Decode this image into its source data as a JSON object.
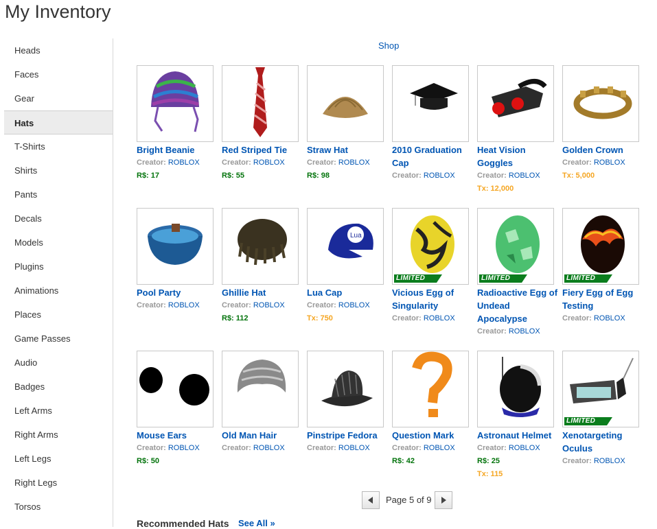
{
  "page": {
    "title": "My Inventory",
    "shop_link": "Shop"
  },
  "sidebar": {
    "items": [
      {
        "label": "Heads"
      },
      {
        "label": "Faces"
      },
      {
        "label": "Gear"
      },
      {
        "label": "Hats"
      },
      {
        "label": "T-Shirts"
      },
      {
        "label": "Shirts"
      },
      {
        "label": "Pants"
      },
      {
        "label": "Decals"
      },
      {
        "label": "Models"
      },
      {
        "label": "Plugins"
      },
      {
        "label": "Animations"
      },
      {
        "label": "Places"
      },
      {
        "label": "Game Passes"
      },
      {
        "label": "Audio"
      },
      {
        "label": "Badges"
      },
      {
        "label": "Left Arms"
      },
      {
        "label": "Right Arms"
      },
      {
        "label": "Left Legs"
      },
      {
        "label": "Right Legs"
      },
      {
        "label": "Torsos"
      }
    ],
    "active": "Hats"
  },
  "creator_label": "Creator: ",
  "limited_label": "LIMITED",
  "items": [
    {
      "name": "Bright Beanie",
      "creator": "ROBLOX",
      "rs": "R$: 17",
      "tx": "",
      "limited": false,
      "icon": "beanie-icon"
    },
    {
      "name": "Red Striped Tie",
      "creator": "ROBLOX",
      "rs": "R$: 55",
      "tx": "",
      "limited": false,
      "icon": "tie-icon"
    },
    {
      "name": "Straw Hat",
      "creator": "ROBLOX",
      "rs": "R$: 98",
      "tx": "",
      "limited": false,
      "icon": "straw-hat-icon"
    },
    {
      "name": "2010 Graduation Cap",
      "creator": "ROBLOX",
      "rs": "",
      "tx": "",
      "limited": false,
      "icon": "graduation-cap-icon"
    },
    {
      "name": "Heat Vision Goggles",
      "creator": "ROBLOX",
      "rs": "",
      "tx": "Tx: 12,000",
      "limited": false,
      "icon": "goggles-icon"
    },
    {
      "name": "Golden Crown",
      "creator": "ROBLOX",
      "rs": "",
      "tx": "Tx: 5,000",
      "limited": false,
      "icon": "crown-icon"
    },
    {
      "name": "Pool Party",
      "creator": "ROBLOX",
      "rs": "",
      "tx": "",
      "limited": false,
      "icon": "pool-icon"
    },
    {
      "name": "Ghillie Hat",
      "creator": "ROBLOX",
      "rs": "R$: 112",
      "tx": "",
      "limited": false,
      "icon": "ghillie-hat-icon"
    },
    {
      "name": "Lua Cap",
      "creator": "ROBLOX",
      "rs": "",
      "tx": "Tx: 750",
      "limited": false,
      "icon": "lua-cap-icon"
    },
    {
      "name": "Vicious Egg of Singularity",
      "creator": "ROBLOX",
      "rs": "",
      "tx": "",
      "limited": true,
      "icon": "yellow-egg-icon"
    },
    {
      "name": "Radioactive Egg of Undead Apocalypse",
      "creator": "ROBLOX",
      "rs": "",
      "tx": "",
      "limited": true,
      "icon": "green-egg-icon"
    },
    {
      "name": "Fiery Egg of Egg Testing",
      "creator": "ROBLOX",
      "rs": "",
      "tx": "",
      "limited": true,
      "icon": "fiery-egg-icon"
    },
    {
      "name": "Mouse Ears",
      "creator": "ROBLOX",
      "rs": "R$: 50",
      "tx": "",
      "limited": false,
      "icon": "mouse-ears-icon"
    },
    {
      "name": "Old Man Hair",
      "creator": "ROBLOX",
      "rs": "",
      "tx": "",
      "limited": false,
      "icon": "hair-icon"
    },
    {
      "name": "Pinstripe Fedora",
      "creator": "ROBLOX",
      "rs": "",
      "tx": "",
      "limited": false,
      "icon": "fedora-icon"
    },
    {
      "name": "Question Mark",
      "creator": "ROBLOX",
      "rs": "R$: 42",
      "tx": "",
      "limited": false,
      "icon": "question-mark-icon"
    },
    {
      "name": "Astronaut Helmet",
      "creator": "ROBLOX",
      "rs": "R$: 25",
      "tx": "Tx: 115",
      "limited": false,
      "icon": "astronaut-helmet-icon"
    },
    {
      "name": "Xenotargeting Oculus",
      "creator": "ROBLOX",
      "rs": "",
      "tx": "",
      "limited": true,
      "icon": "oculus-icon"
    }
  ],
  "pager": {
    "text": "Page 5 of 9"
  },
  "recommended": {
    "title": "Recommended Hats",
    "see_all": "See All »"
  }
}
